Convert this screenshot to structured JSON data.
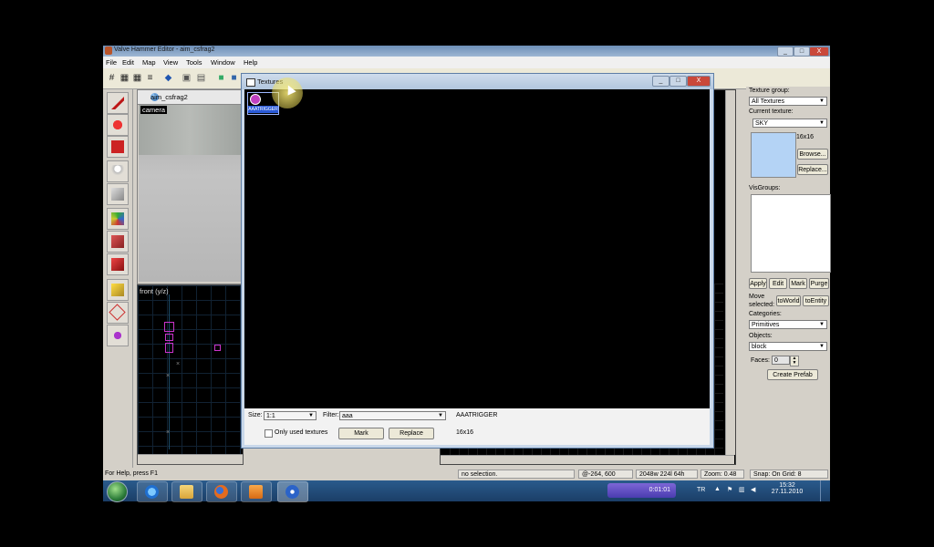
{
  "app": {
    "title": "Valve Hammer Editor - aim_csfrag2",
    "menu": [
      "File",
      "Edit",
      "Map",
      "View",
      "Tools",
      "Window",
      "Help"
    ],
    "window_buttons": {
      "minimize": "_",
      "maximize": "□",
      "close": "X"
    }
  },
  "viewports": {
    "camera": {
      "tab_title": "aim_csfrag2",
      "label": "camera"
    },
    "front": {
      "label": "front (y/z)"
    }
  },
  "right_panel": {
    "texture_group_label": "Texture group:",
    "texture_group_value": "All Textures",
    "current_texture_label": "Current texture:",
    "current_texture_value": "SKY",
    "texture_size": "16x16",
    "browse_label": "Browse...",
    "replace_label": "Replace...",
    "visgroups_label": "VisGroups:",
    "apply_label": "Apply",
    "edit_label": "Edit",
    "mark_label": "Mark",
    "purge_label": "Purge",
    "move_selected_label": "Move selected:",
    "toworld_label": "toWorld",
    "toentity_label": "toEntity",
    "categories_label": "Categories:",
    "categories_value": "Primitives",
    "objects_label": "Objects:",
    "objects_value": "block",
    "faces_label": "Faces:",
    "faces_value": "0",
    "create_prefab_label": "Create Prefab"
  },
  "textures_dialog": {
    "title": "Textures",
    "thumb_name": "AAATRIGGER",
    "size_label": "Size:",
    "size_value": "1:1",
    "filter_label": "Filter:",
    "filter_value": "aaa",
    "selected_name": "AAATRIGGER",
    "selected_size": "16x16",
    "only_used_label": "Only used textures",
    "mark_label": "Mark",
    "replace_label": "Replace"
  },
  "status": {
    "help": "For Help, press F1",
    "selection": "no selection.",
    "coords": "@-264, 600",
    "dimensions": "2048w 224l 64h",
    "zoom": "Zoom: 0.48",
    "snap": "Snap: On Grid: 8"
  },
  "taskbar": {
    "media_time": "0:01:01",
    "language": "TR",
    "time": "15:32",
    "date": "27.11.2010"
  }
}
